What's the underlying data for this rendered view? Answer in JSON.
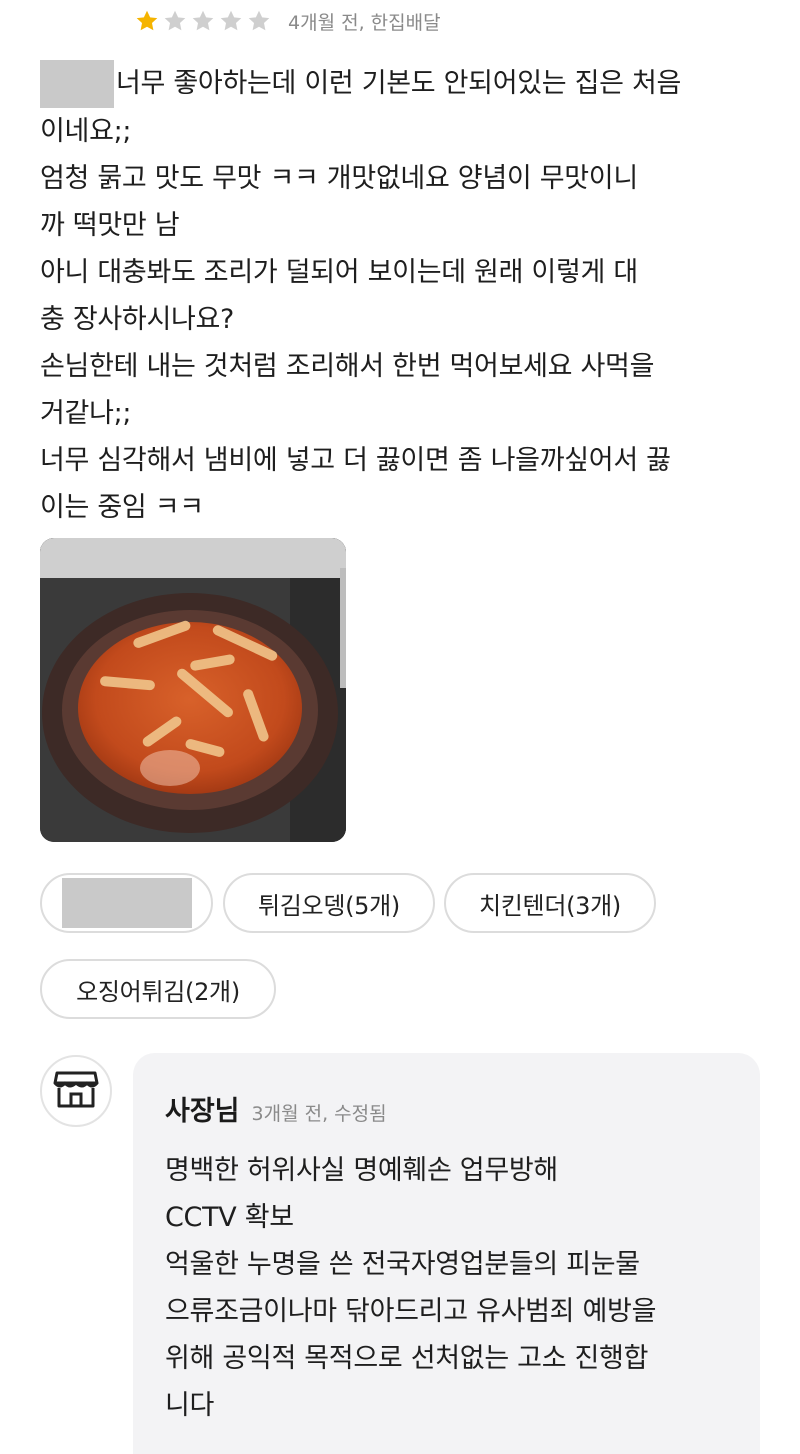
{
  "review": {
    "rating": 1,
    "rating_max": 5,
    "star_filled_color": "#f5b400",
    "star_empty_color": "#cfcfcf",
    "meta": "4개월 전, 한집배달",
    "lines": [
      "너무 좋아하는데 이런 기본도 안되어있는 집은 처음",
      "이네요;;",
      "엄청 묽고 맛도 무맛 ㅋㅋ 개맛없네요 양념이 무맛이니",
      "까 떡맛만 남",
      "아니 대충봐도 조리가 덜되어 보이는데 원래 이렇게 대",
      "충 장사하시나요?",
      "손님한테 내는 것처럼 조리해서 한번 먹어보세요 사먹을",
      "거같나;;",
      "너무 심각해서 냄비에 넣고 더 끓이면 좀 나을까싶어서 끓",
      "이는 중임 ㅋㅋ"
    ]
  },
  "menu_chips": [
    "튀김오뎅(5개)",
    "치킨텐더(3개)",
    "오징어튀김(2개)"
  ],
  "owner_reply": {
    "name": "사장님",
    "meta": "3개월 전, 수정됨",
    "lines": [
      "명백한 허위사실 명예훼손 업무방해",
      "CCTV 확보",
      "억울한 누명을 쓴 전국자영업분들의 피눈물",
      "으류조금이나마 닦아드리고 유사범죄 예방을",
      "위해 공익적 목적으로 선처없는 고소 진행합",
      "니다"
    ]
  },
  "icons": {
    "star": "star-icon",
    "store": "store-icon"
  }
}
